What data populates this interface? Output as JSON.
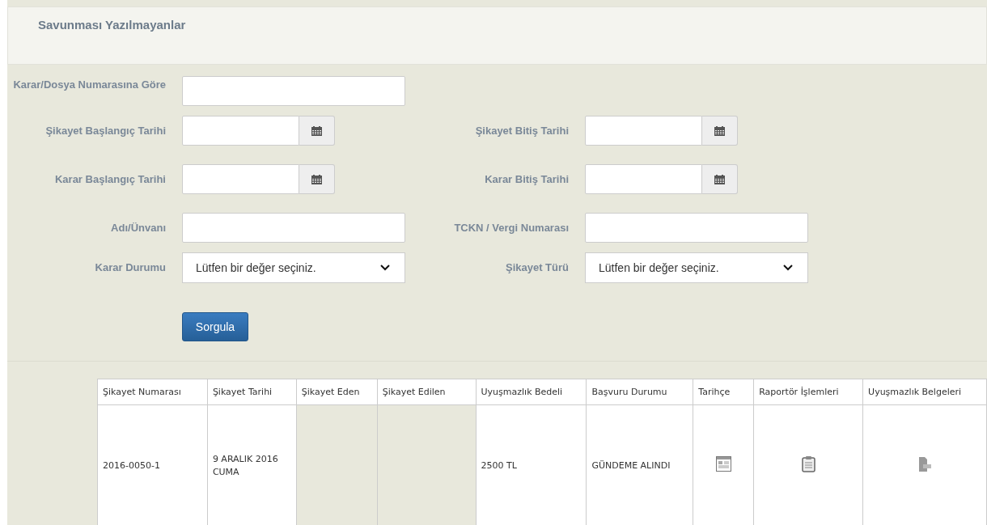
{
  "header": {
    "title": "Savunması Yazılmayanlar"
  },
  "form_rows": [
    {
      "left": {
        "label": "Karar/Dosya Numarasına Göre",
        "kind": "text"
      }
    },
    {
      "left": {
        "label": "Şikayet Başlangıç Tarihi",
        "kind": "date"
      },
      "right": {
        "label": "Şikayet Bitiş Tarihi",
        "kind": "date"
      }
    },
    {
      "left": {
        "label": "Karar Başlangıç Tarihi",
        "kind": "date"
      },
      "right": {
        "label": "Karar Bitiş Tarihi",
        "kind": "date"
      }
    },
    {
      "left": {
        "label": "Adı/Ünvanı",
        "kind": "text"
      },
      "right": {
        "label": "TCKN / Vergi Numarası",
        "kind": "text"
      }
    },
    {
      "left": {
        "label": "Karar Durumu",
        "kind": "select",
        "value": "Lütfen bir değer seçiniz."
      },
      "right": {
        "label": "Şikayet Türü",
        "kind": "select",
        "value": "Lütfen bir değer seçiniz."
      }
    }
  ],
  "query_button": "Sorgula",
  "table": {
    "columns": [
      "Şikayet Numarası",
      "Şikayet Tarihi",
      "Şikayet Eden",
      "Şikayet Edilen",
      "Uyuşmazlık Bedeli",
      "Başvuru Durumu",
      "Tarihçe",
      "Raportör İşlemleri",
      "Uyuşmazlık Belgeleri"
    ],
    "rows": [
      {
        "cells": [
          {
            "kind": "text",
            "text": "2016-0050-1"
          },
          {
            "kind": "text",
            "text": "9 ARALIK 2016 CUMA"
          },
          {
            "kind": "empty"
          },
          {
            "kind": "empty"
          },
          {
            "kind": "text",
            "text": "2500 TL"
          },
          {
            "kind": "text",
            "text": "GÜNDEME ALINDI"
          },
          {
            "kind": "page"
          },
          {
            "kind": "clipboard"
          },
          {
            "kind": "file"
          }
        ]
      }
    ]
  }
}
